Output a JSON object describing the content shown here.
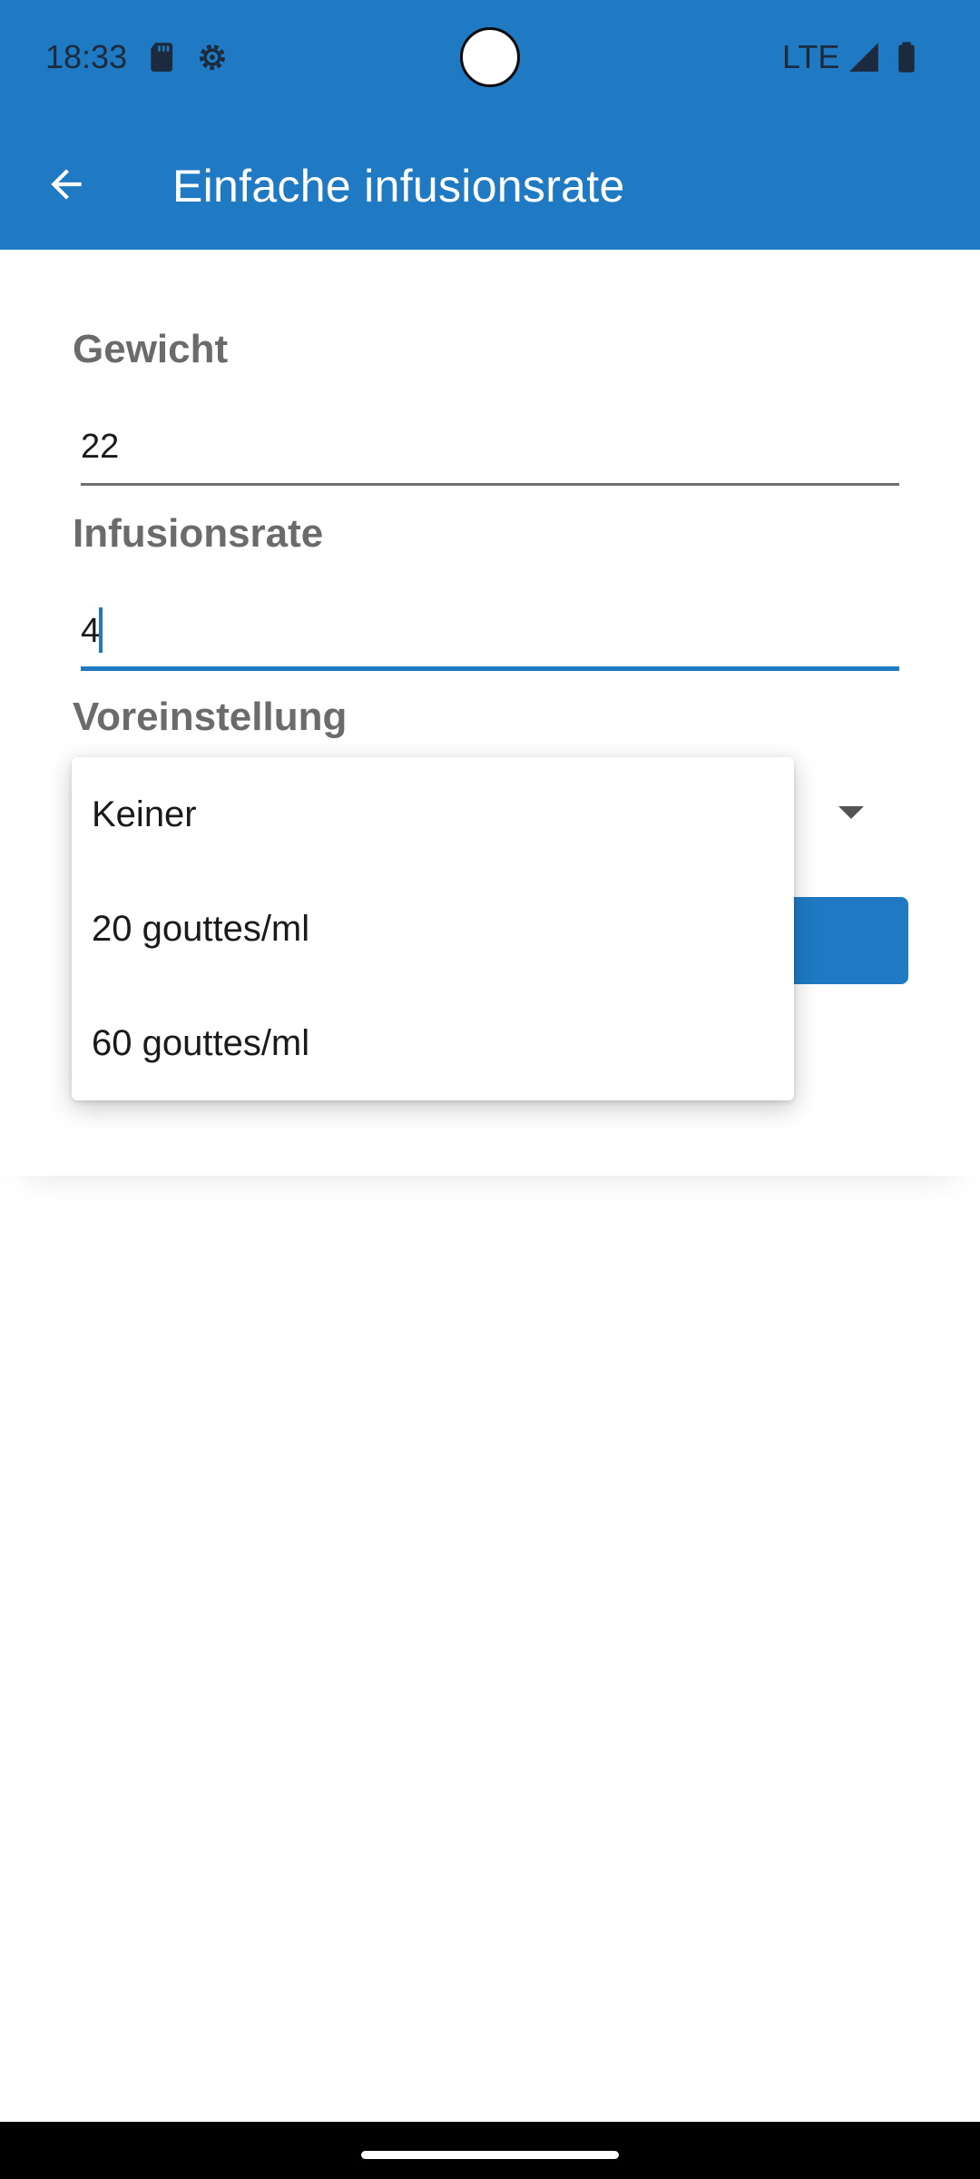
{
  "status_bar": {
    "time": "18:33",
    "network": "LTE",
    "icons": [
      "sd-card-icon",
      "settings-gear-icon",
      "signal-icon",
      "battery-icon"
    ]
  },
  "app_bar": {
    "title": "Einfache infusionsrate",
    "back_icon": "arrow-left-icon",
    "background_color": "#1f7ac3"
  },
  "form": {
    "weight": {
      "label": "Gewicht",
      "value": "22"
    },
    "infusion_rate": {
      "label": "Infusionsrate",
      "value": "4"
    },
    "preset": {
      "label": "Voreinstellung",
      "arrow_icon": "dropdown-arrow-icon"
    }
  },
  "dropdown_menu": {
    "options": [
      "Keiner",
      "20 gouttes/ml",
      "60 gouttes/ml"
    ]
  },
  "colors": {
    "accent": "#1f7ac3",
    "label_gray": "#6b6b6b",
    "text": "#1a1a1a"
  }
}
